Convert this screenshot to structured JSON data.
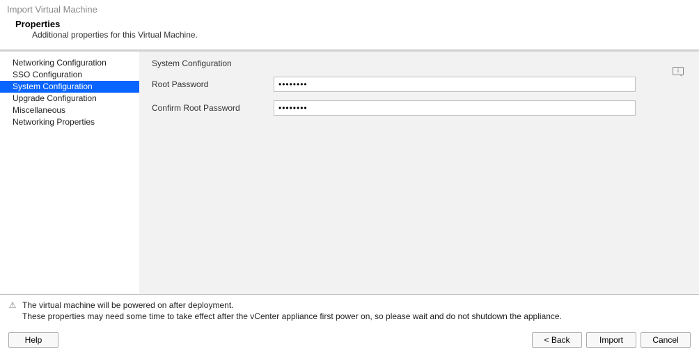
{
  "window": {
    "title": "Import Virtual Machine"
  },
  "header": {
    "title": "Properties",
    "subtitle": "Additional properties for this Virtual Machine."
  },
  "sidebar": {
    "items": [
      {
        "label": "Networking Configuration"
      },
      {
        "label": "SSO Configuration"
      },
      {
        "label": "System Configuration"
      },
      {
        "label": "Upgrade Configuration"
      },
      {
        "label": "Miscellaneous"
      },
      {
        "label": "Networking Properties"
      }
    ],
    "selected_index": 2
  },
  "panel": {
    "heading": "System Configuration",
    "fields": {
      "root_password": {
        "label": "Root Password",
        "value": "••••••••"
      },
      "confirm_root_password": {
        "label": "Confirm Root Password",
        "value": "••••••••"
      }
    }
  },
  "messages": {
    "line1": "The virtual machine will be powered on after deployment.",
    "line2": "These properties may need some time to take effect after the vCenter appliance first power on, so please wait and do not shutdown the appliance."
  },
  "buttons": {
    "help": "Help",
    "back": "< Back",
    "import": "Import",
    "cancel": "Cancel"
  }
}
